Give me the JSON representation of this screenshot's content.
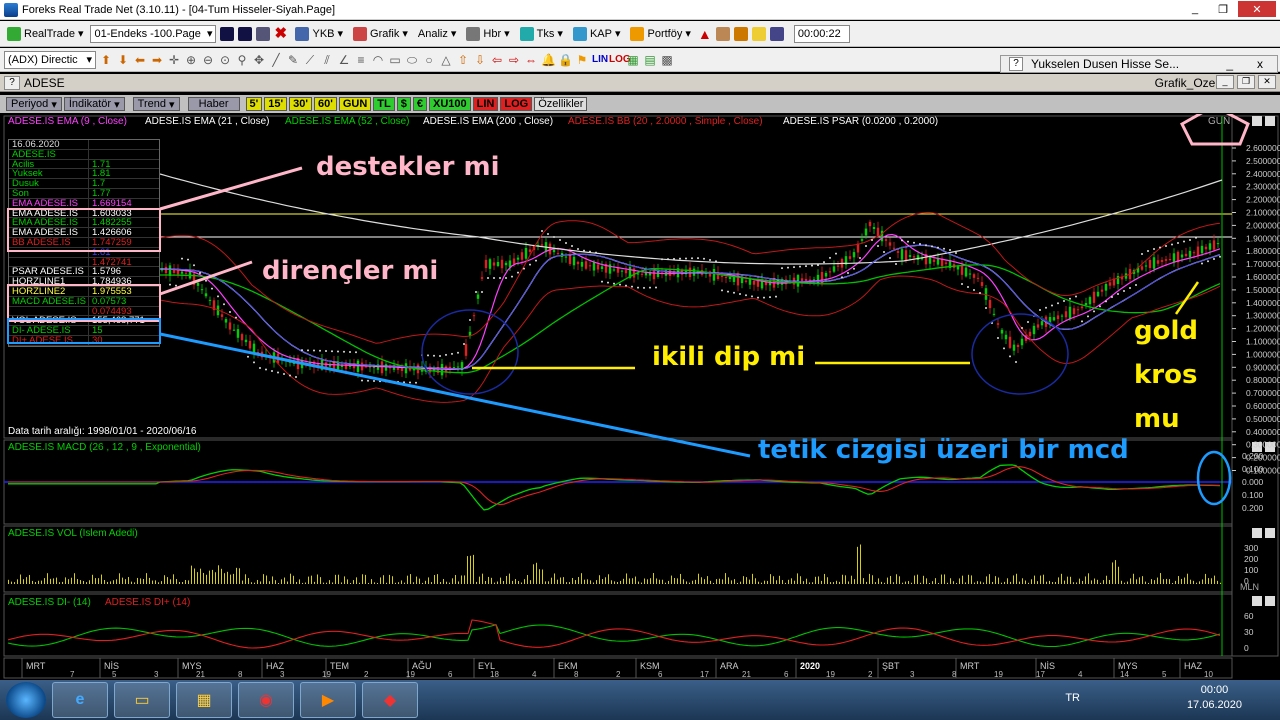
{
  "window": {
    "title": "Foreks Real Trade Net (3.10.11) - [04-Tum Hisseler-Siyah.Page]"
  },
  "toolbar": {
    "realtrade": "RealTrade",
    "page_select": "01-Endeks -100.Page",
    "ykb": "YKB",
    "grafik": "Grafik",
    "analiz": "Analiz",
    "hbr": "Hbr",
    "tks": "Tks",
    "kap": "KAP",
    "portfoy": "Portföy",
    "clock": "00:00:22"
  },
  "toolbar2": {
    "indicator_select": "(ADX) Directic"
  },
  "subwindow": {
    "q": "?",
    "title": "Yukselen Dusen Hisse Se...",
    "min": "_",
    "close": "x"
  },
  "mdi": {
    "q": "?",
    "symbol": "ADESE",
    "grafik": "Grafik_Ozel"
  },
  "chartbar": {
    "periyod": "Periyod",
    "indikator": "İndikatör",
    "trend": "Trend",
    "haber": "Haber",
    "p5": "5'",
    "p15": "15'",
    "p30": "30'",
    "p60": "60'",
    "gun": "GUN",
    "tl": "TL",
    "dollar": "$",
    "euro": "€",
    "xu100": "XU100",
    "lin": "LIN",
    "log": "LOG",
    "ozellikler": "Özellikler"
  },
  "legend": {
    "ema9": "ADESE.IS EMA (9 , Close)",
    "ema21": "ADESE.IS EMA (21 , Close)",
    "ema52": "ADESE.IS EMA (52 , Close)",
    "ema200": "ADESE.IS EMA (200 , Close)",
    "bb": "ADESE.IS BB (20 , 2.0000 , Simple , Close)",
    "psar": "ADESE.IS PSAR (0.0200 , 0.2000)",
    "gun": "GUN"
  },
  "infobox": {
    "rows": [
      {
        "k": "16.06.2020",
        "v": "",
        "c": "#ddd"
      },
      {
        "k": "ADESE.IS",
        "v": "",
        "c": "#00d000"
      },
      {
        "k": "Acilis",
        "v": "1.71",
        "c": "#00d000"
      },
      {
        "k": "Yuksek",
        "v": "1.81",
        "c": "#00d000"
      },
      {
        "k": "Dusuk",
        "v": "1.7",
        "c": "#00d000"
      },
      {
        "k": "Son",
        "v": "1.77",
        "c": "#00d000"
      },
      {
        "k": "EMA ADESE.IS",
        "v": "1.669154",
        "c": "#ff40ff"
      },
      {
        "k": "EMA ADESE.IS",
        "v": "1.603033",
        "c": "#ffffff"
      },
      {
        "k": "EMA ADESE.IS",
        "v": "1.482255",
        "c": "#00d000"
      },
      {
        "k": "EMA ADESE.IS",
        "v": "1.426606",
        "c": "#ffffff"
      },
      {
        "k": "BB ADESE.IS",
        "v": "1.747259",
        "c": "#e02020"
      },
      {
        "k": "",
        "v": "1.61",
        "c": "#4040ff"
      },
      {
        "k": "",
        "v": "1.472741",
        "c": "#e02020"
      },
      {
        "k": "PSAR ADESE.IS",
        "v": "1.5796",
        "c": "#ffffff"
      },
      {
        "k": "HORZLINE1",
        "v": "1.784936",
        "c": "#ffffff"
      },
      {
        "k": "HORZLINE2",
        "v": "1.975553",
        "c": "#ffff40"
      },
      {
        "k": "MACD ADESE.IS",
        "v": "0.07573",
        "c": "#00d000"
      },
      {
        "k": "",
        "v": "0.074493",
        "c": "#e02020"
      },
      {
        "k": "VOL ADESE.IS",
        "v": "155,468,771",
        "c": "#ffffff"
      },
      {
        "k": "DI- ADESE.IS",
        "v": "15",
        "c": "#00d000"
      },
      {
        "k": "DI+ ADESE.IS",
        "v": "30",
        "c": "#e02020"
      }
    ]
  },
  "date_range": "Data tarih aralığı: 1998/01/01 - 2020/06/16",
  "panels": {
    "macd": "ADESE.IS MACD (26 , 12 , 9 , Exponential)",
    "vol": "ADESE.IS VOL (Islem Adedi)",
    "di_minus": "ADESE.IS DI- (14)",
    "di_plus": "ADESE.IS DI+ (14)",
    "mln": "MLN"
  },
  "axis": {
    "price_ticks": [
      "2.600000",
      "2.500000",
      "2.400000",
      "2.300000",
      "2.200000",
      "2.100000",
      "2.000000",
      "1.900000",
      "1.800000",
      "1.700000",
      "1.600000",
      "1.500000",
      "1.400000",
      "1.300000",
      "1.200000",
      "1.100000",
      "1.000000",
      "0.900000",
      "0.800000",
      "0.700000",
      "0.600000",
      "0.500000",
      "0.400000",
      "0.300000",
      "0.200000",
      "0.100000"
    ],
    "macd_ticks": [
      "0.200000",
      "0.100000",
      "0.000000",
      "-0.100000",
      "-0.200000"
    ],
    "macd_tick_labels": [
      "0.200",
      "0.100",
      "0.000",
      "0.100",
      "0.200"
    ],
    "vol_ticks": [
      "300",
      "200",
      "100",
      "0"
    ],
    "di_ticks": [
      "60",
      "30",
      "0"
    ],
    "months": [
      "MRT",
      "NİS",
      "MYS",
      "HAZ",
      "TEM",
      "AĞU",
      "EYL",
      "EKM",
      "KSM",
      "ARA",
      "2020",
      "ŞBT",
      "MRT",
      "NİS",
      "MYS",
      "HAZ"
    ],
    "days": [
      "7",
      "5",
      "3",
      "21",
      "8",
      "3",
      "19",
      "2",
      "19",
      "6",
      "18",
      "4",
      "8",
      "2",
      "6",
      "17",
      "21",
      "6",
      "19",
      "2",
      "3",
      "8",
      "19",
      "17",
      "4",
      "14",
      "5",
      "10"
    ]
  },
  "annotations": {
    "destekler": "destekler mi",
    "direncler": "dirençler mi",
    "ikili": "ikili dip mi",
    "gold1": "gold",
    "gold2": "kros",
    "gold3": "mu",
    "tetik": "tetik cizgisi üzeri bir mcd"
  },
  "taskbar": {
    "lang": "TR",
    "time": "00:00",
    "date": "17.06.2020"
  },
  "colors": {
    "pink": "#ffb6c8",
    "yellow": "#ffee00",
    "blue": "#1e9bff"
  }
}
